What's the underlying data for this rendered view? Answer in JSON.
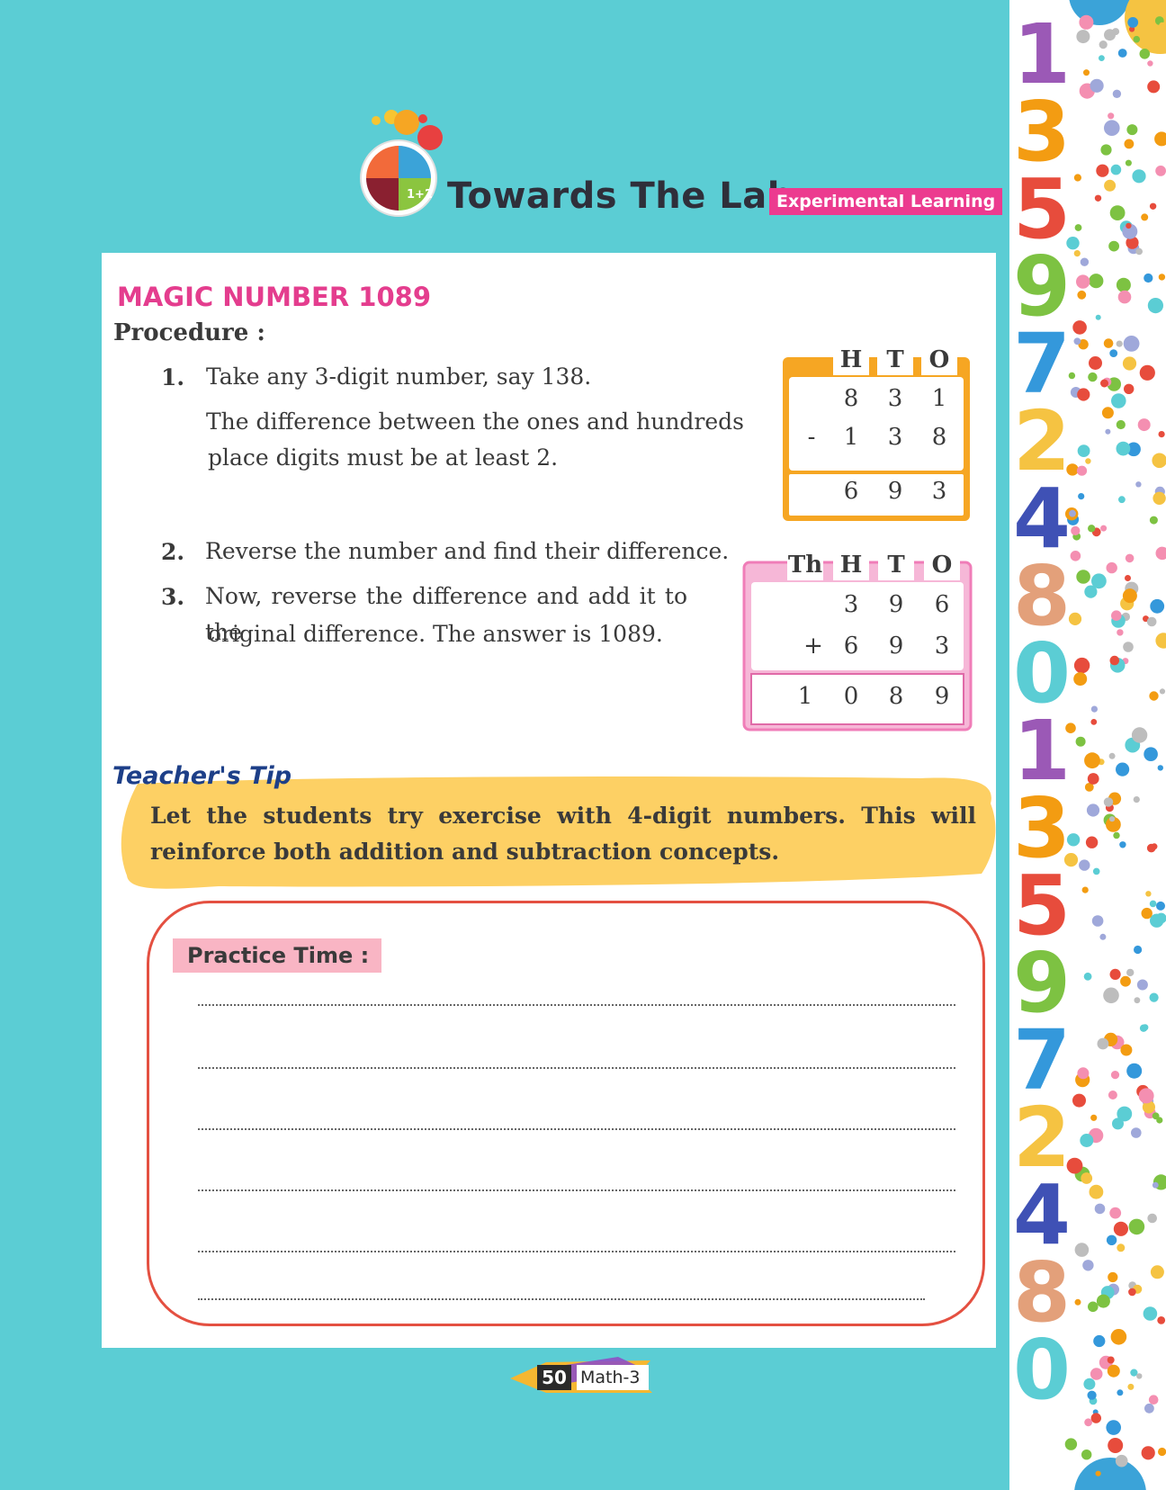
{
  "header": {
    "brand": "Towards The Lab",
    "badge": "Experimental Learning",
    "logo_text": "1+2"
  },
  "section": {
    "title": "MAGIC NUMBER 1089",
    "procedure_label": "Procedure :"
  },
  "steps": [
    {
      "num": "1.",
      "lines": [
        "Take any 3-digit number, say 138.",
        "The difference between the ones and hundreds",
        "place digits must be at least 2."
      ]
    },
    {
      "num": "2.",
      "lines": [
        "Reverse the number and find their difference."
      ]
    },
    {
      "num": "3.",
      "lines": [
        "Now, reverse the difference and add it to the",
        "original difference. The answer is 1089."
      ]
    }
  ],
  "subtraction_table": {
    "headers": [
      "H",
      "T",
      "O"
    ],
    "row1": [
      "8",
      "3",
      "1"
    ],
    "op": "-",
    "row2": [
      "1",
      "3",
      "8"
    ],
    "result": [
      "6",
      "9",
      "3"
    ]
  },
  "addition_table": {
    "headers": [
      "Th",
      "H",
      "T",
      "O"
    ],
    "row1": [
      "3",
      "9",
      "6"
    ],
    "op": "+",
    "row2": [
      "6",
      "9",
      "3"
    ],
    "result": [
      "1",
      "0",
      "8",
      "9"
    ]
  },
  "teacher_tip": {
    "title": "Teacher's Tip",
    "text": "Let the students try exercise with 4-digit numbers. This will reinforce both addition and subtraction concepts."
  },
  "practice": {
    "label": "Practice Time :"
  },
  "footer": {
    "page": "50",
    "book": "Math-3"
  },
  "side_digits": [
    "1",
    "3",
    "5",
    "9",
    "7",
    "2",
    "4",
    "8",
    "0",
    "1",
    "3",
    "5",
    "9",
    "7",
    "2",
    "4",
    "8",
    "0"
  ],
  "colors": {
    "background": "#5bcdd4",
    "title_pink": "#e43d8e",
    "orange": "#f6a623",
    "pink_border": "#f07db8",
    "tip_yellow": "#fdd064",
    "practice_red": "#e45041"
  }
}
